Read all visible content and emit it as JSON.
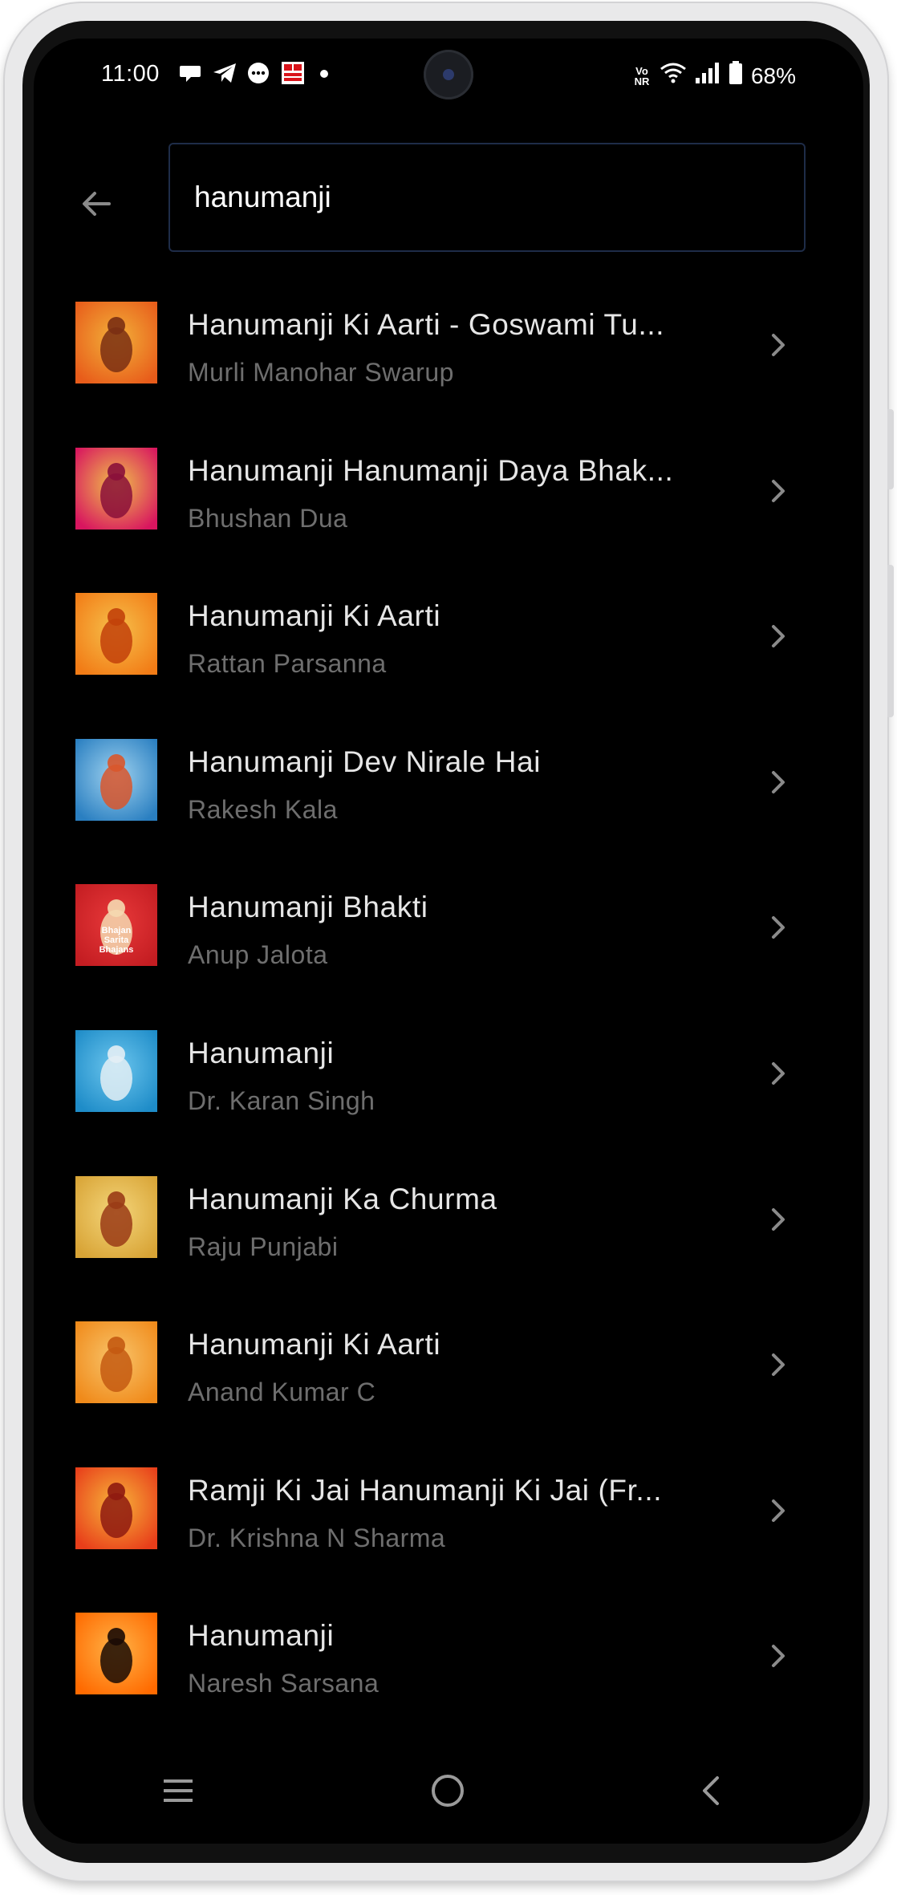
{
  "status_bar": {
    "time": "11:00",
    "battery": "68%",
    "network_label": "Vo NR",
    "notification_icons": [
      "chat-bubble-icon",
      "telegram-icon",
      "messenger-icon",
      "news-app-icon",
      "dot-icon"
    ]
  },
  "search": {
    "query": "hanumanji"
  },
  "results": [
    {
      "title": "Hanumanji Ki Aarti - Goswami Tu...",
      "artist": "Murli Manohar Swarup",
      "art": [
        "#e85c1a",
        "#f2b13a",
        "#7a2f13"
      ]
    },
    {
      "title": "Hanumanji Hanumanji Daya Bhak...",
      "artist": "Bhushan Dua",
      "art": [
        "#d8155f",
        "#f0c24a",
        "#8a0f3a"
      ]
    },
    {
      "title": "Hanumanji Ki Aarti",
      "artist": "Rattan Parsanna",
      "art": [
        "#f27c16",
        "#f6c04b",
        "#c2410a"
      ]
    },
    {
      "title": "Hanumanji Dev Nirale Hai",
      "artist": "Rakesh Kala",
      "art": [
        "#2a7fc1",
        "#9fd2ef",
        "#d9562b"
      ]
    },
    {
      "title": "Hanumanji Bhakti",
      "artist": "Anup Jalota",
      "art": [
        "#c41d22",
        "#e8393a",
        "#f5d9b0"
      ],
      "art_text": [
        "Bhajan",
        "Sarita",
        "Bhajans"
      ]
    },
    {
      "title": "Hanumanji",
      "artist": "Dr. Karan Singh",
      "art": [
        "#1e8cc8",
        "#6cc6ee",
        "#e3eef5"
      ]
    },
    {
      "title": "Hanumanji Ka Churma",
      "artist": "Raju Punjabi",
      "art": [
        "#d8a436",
        "#f4d57a",
        "#9a3b16"
      ]
    },
    {
      "title": "Hanumanji Ki Aarti",
      "artist": "Anand Kumar C",
      "art": [
        "#f08a1a",
        "#f8c46a",
        "#c45a12"
      ]
    },
    {
      "title": "Ramji Ki Jai Hanumanji Ki Jai (Fr...",
      "artist": "Dr. Krishna N Sharma",
      "art": [
        "#e83e1a",
        "#f7b43a",
        "#8e1a10"
      ]
    },
    {
      "title": "Hanumanji",
      "artist": "Naresh Sarsana",
      "art": [
        "#ff6a00",
        "#ffb347",
        "#1a0a04"
      ]
    }
  ]
}
